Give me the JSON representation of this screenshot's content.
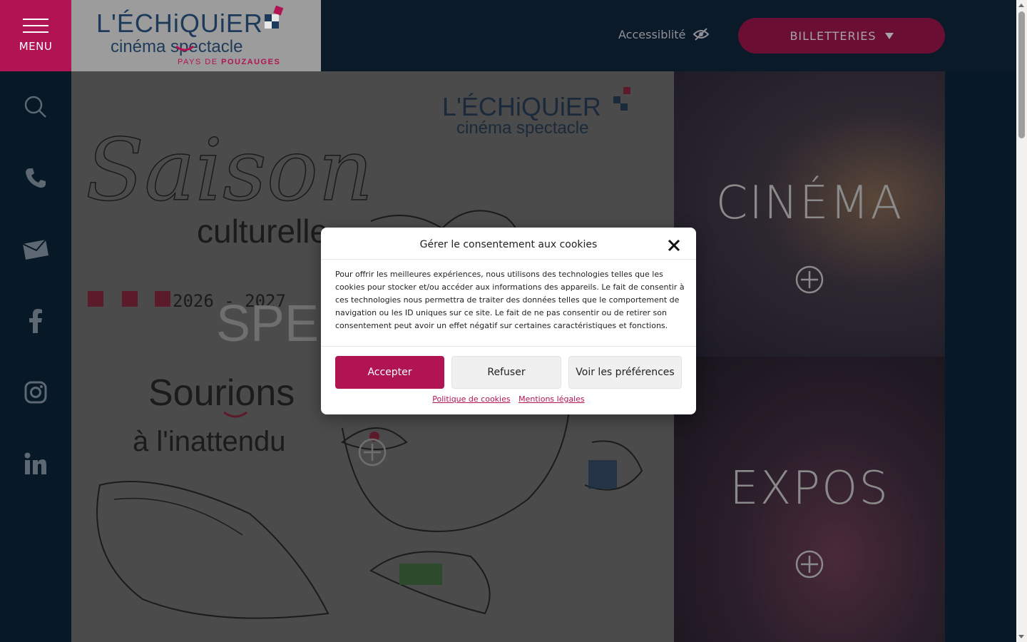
{
  "header": {
    "menu_label": "MENU",
    "logo": {
      "line1": "L'ÉCHiQUiER",
      "line2": "cinéma spectacle",
      "line3_a": "PAYS DE ",
      "line3_b": "POUZAUGES"
    },
    "accessibility_label": "Accessiblité",
    "ticket_label": "BILLETTERIES"
  },
  "rail": {
    "icons": [
      "search-icon",
      "phone-icon",
      "mail-icon",
      "facebook-icon",
      "instagram-icon",
      "linkedin-icon"
    ]
  },
  "poster": {
    "saison": "Saison",
    "culturelle": "culturelle",
    "year": "2026 - 2027",
    "spectacle_label": "SPE",
    "slogan1": "Sourions",
    "slogan2": "à l'inattendu"
  },
  "tiles": {
    "cinema": "CINÉMA",
    "expos": "EXPOS"
  },
  "cookie": {
    "title": "Gérer le consentement aux cookies",
    "text": "Pour offrir les meilleures expériences, nous utilisons des technologies telles que les cookies pour stocker et/ou accéder aux informations des appareils. Le fait de consentir à ces technologies nous permettra de traiter des données telles que le comportement de navigation ou les ID uniques sur ce site. Le fait de ne pas consentir ou de retirer son consentement peut avoir un effet négatif sur certaines caractéristiques et fonctions.",
    "accept": "Accepter",
    "refuse": "Refuser",
    "prefs": "Voir les préférences",
    "policy_link": "Politique de cookies",
    "legal_link": "Mentions légales"
  },
  "colors": {
    "brand_pink": "#b11453",
    "navy": "#071827"
  }
}
